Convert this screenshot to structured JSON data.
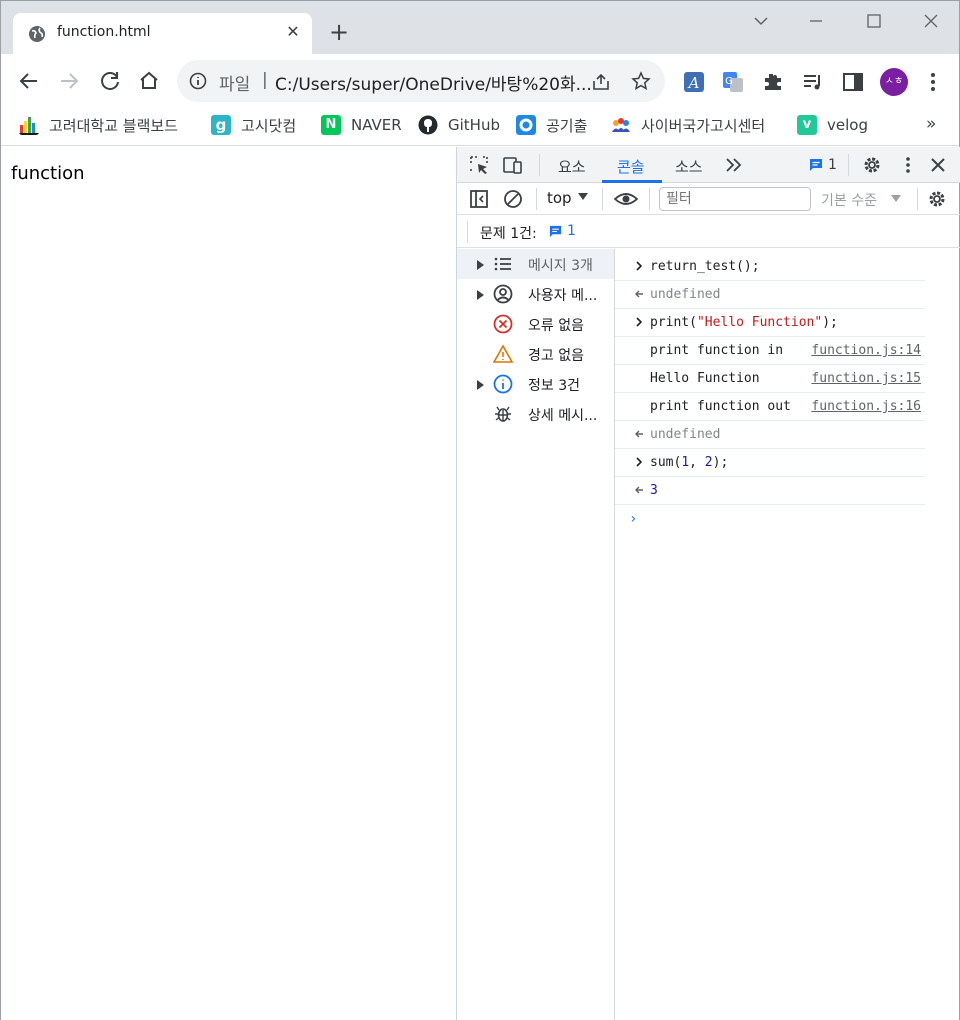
{
  "browser": {
    "tab": {
      "title": "function.html",
      "favicon": "globe-icon"
    },
    "omnibox": {
      "scheme_label": "파일",
      "url": "C:/Users/super/OneDrive/바탕%20화..."
    },
    "bookmarks": [
      {
        "label": "고려대학교 블랙보드",
        "icon": "bars-icon",
        "color": "#1a1a1a"
      },
      {
        "label": "고시닷컴",
        "icon": "g-icon",
        "color": "#2bb5c6"
      },
      {
        "label": "NAVER",
        "icon": "naver-icon",
        "color": "#03c75a"
      },
      {
        "label": "GitHub",
        "icon": "github-icon",
        "color": "#24292f"
      },
      {
        "label": "공기출",
        "icon": "ring-icon",
        "color": "#1e88e5"
      },
      {
        "label": "사이버국가고시센터",
        "icon": "people-icon",
        "color": "#f5a623"
      },
      {
        "label": "velog",
        "icon": "v-icon",
        "color": "#20c997"
      }
    ],
    "bookmarks_more": "»",
    "avatar_initials": "ㅅㅎ"
  },
  "page": {
    "body_text": "function"
  },
  "devtools": {
    "tabs": [
      "요소",
      "콘솔",
      "소스"
    ],
    "active_tab": "콘솔",
    "message_badge": "1",
    "context": "top",
    "filter_placeholder": "필터",
    "levels_label": "기본 수준",
    "issues": {
      "label": "문제 1건:",
      "count": "1"
    },
    "sidebar": [
      {
        "label": "메시지 3개",
        "icon": "list-icon",
        "expandable": true
      },
      {
        "label": "사용자 메...",
        "icon": "user-icon",
        "expandable": true
      },
      {
        "label": "오류 없음",
        "icon": "error-icon",
        "expandable": false
      },
      {
        "label": "경고 없음",
        "icon": "warning-icon",
        "expandable": false
      },
      {
        "label": "정보 3건",
        "icon": "info-icon",
        "expandable": true
      },
      {
        "label": "상세 메시...",
        "icon": "bug-icon",
        "expandable": false
      }
    ],
    "console": [
      {
        "kind": "input",
        "text": "return_test();"
      },
      {
        "kind": "result",
        "text": "undefined"
      },
      {
        "kind": "input",
        "pre": "print(",
        "str": "\"Hello Function\"",
        "post": ");"
      },
      {
        "kind": "log",
        "text": "print function in",
        "source": "function.js:14"
      },
      {
        "kind": "log",
        "text": "Hello Function",
        "source": "function.js:15"
      },
      {
        "kind": "log",
        "text": "print function out",
        "source": "function.js:16"
      },
      {
        "kind": "result",
        "text": "undefined"
      },
      {
        "kind": "input",
        "pre": "sum(",
        "n1": "1",
        "mid": ", ",
        "n2": "2",
        "post": ");"
      },
      {
        "kind": "result",
        "text": "3"
      }
    ]
  }
}
